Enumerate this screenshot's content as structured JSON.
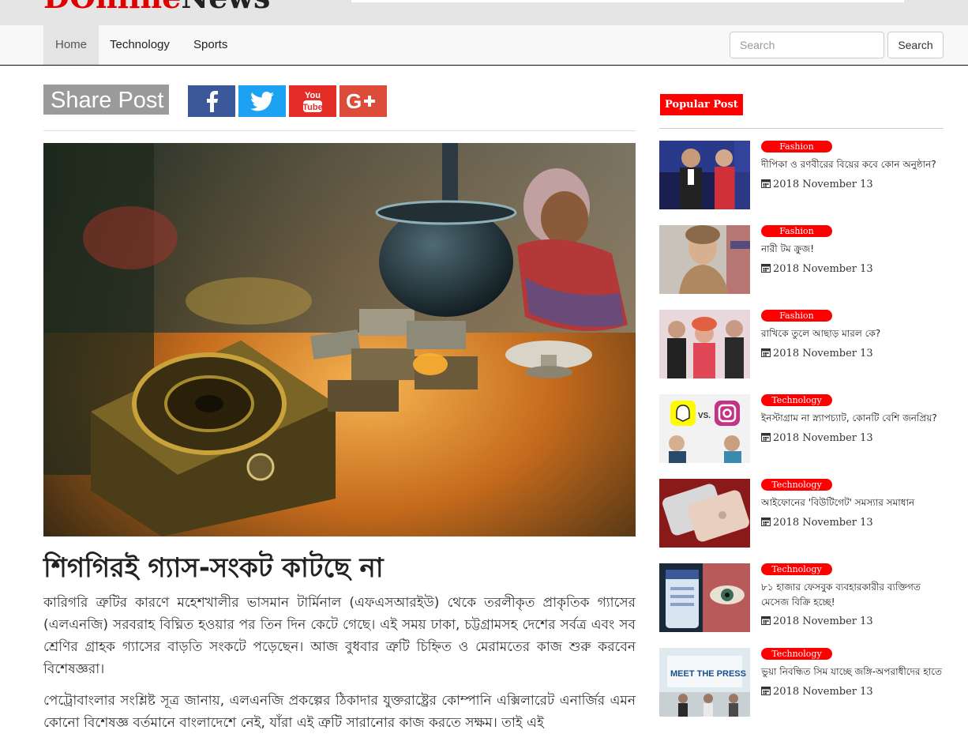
{
  "logo": {
    "part1": "D",
    "part2": "Online",
    "part3": "News"
  },
  "nav": {
    "home": "Home",
    "technology": "Technology",
    "sports": "Sports"
  },
  "search": {
    "placeholder": "Search",
    "button": "Search"
  },
  "share": {
    "label": "Share Post",
    "icons": [
      "facebook-icon",
      "twitter-icon",
      "youtube-icon",
      "google-plus-icon"
    ],
    "colors": {
      "facebook": "#3b5998",
      "twitter": "#1da1f2",
      "youtube": "#e52d27",
      "google_plus": "#dd4b39"
    }
  },
  "article": {
    "headline": "শিগগিরই গ্যাস-সংকট কাটছে না",
    "paragraphs": [
      "কারিগরি ত্রুটির কারণে মহেশখালীর ভাসমান টার্মিনাল (এফএসআরইউ) থেকে তরলীকৃত প্রাকৃতিক গ্যাসের (এলএনজি) সরবরাহ বিঘ্নিত হওয়ার পর তিন দিন কেটে গেছে। এই সময় ঢাকা, চট্টগ্রামসহ দেশের সর্বত্র এবং সব শ্রেণির গ্রাহক গ্যাসের বাড়তি সংকটে পড়েছেন। আজ বুধবার ত্রুটি চিহ্নিত ও মেরামতের কাজ শুরু করবেন বিশেষজ্ঞরা।",
      "পেট্রোবাংলার সংশ্লিষ্ট সূত্র জানায়, এলএনজি প্রকল্পের ঠিকাদার যুক্তরাষ্ট্রের কোম্পানি এক্সিলারেট এনার্জির এমন কোনো বিশেষজ্ঞ বর্তমানে বাংলাদেশে নেই, যাঁরা এই ত্রুটি সারানোর কাজ করতে সক্ষম। তাই এই"
    ]
  },
  "sidebar": {
    "title": "Popular Post",
    "accent": "#ff0000",
    "posts": [
      {
        "category": "Fashion",
        "title": "দীপিকা ও রণবীরের বিয়ের কবে কোন অনুষ্ঠান?",
        "date": "2018 November 13"
      },
      {
        "category": "Fashion",
        "title": "নারী টম ক্রুজ!",
        "date": "2018 November 13"
      },
      {
        "category": "Fashion",
        "title": "রাখিকে তুলে আছাড় মারল কে?",
        "date": "2018 November 13"
      },
      {
        "category": "Technology",
        "title": "ইনস্টাগ্রাম না স্ন্যাপচ্যাট, কোনটি বেশি জনপ্রিয়?",
        "date": "2018 November 13"
      },
      {
        "category": "Technology",
        "title": "আইফোনের 'বিউটিগেট' সমস্যার সমাধান",
        "date": "2018 November 13"
      },
      {
        "category": "Technology",
        "title": "৮১ হাজার ফেসবুক ব্যবহারকারীর ব্যক্তিগত মেসেজ বিক্রি হচ্ছে!",
        "date": "2018 November 13"
      },
      {
        "category": "Technology",
        "title": "ভুয়া নিবন্ধিত সিম যাচ্ছে জঙ্গি-অপরাধীদের হাতে",
        "date": "2018 November 13"
      }
    ]
  }
}
